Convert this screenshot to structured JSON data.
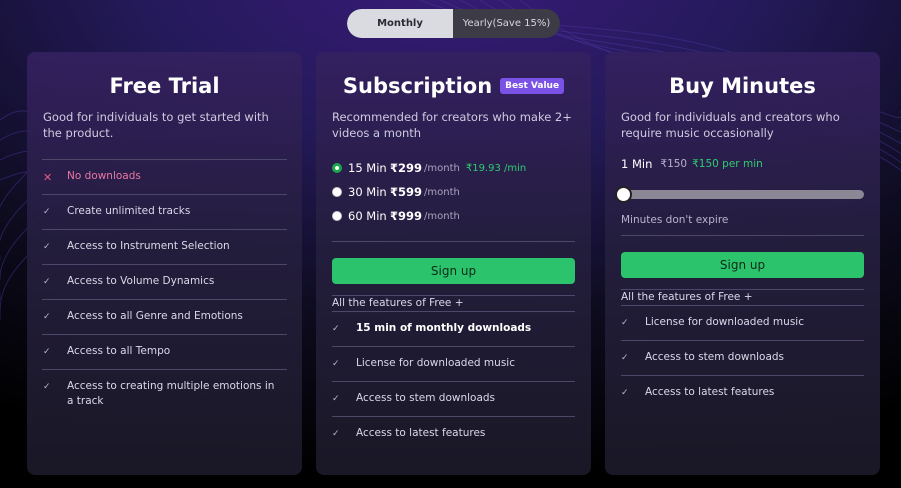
{
  "billing_toggle": {
    "monthly": "Monthly",
    "yearly": "Yearly(Save 15%)"
  },
  "free_trial": {
    "title": "Free Trial",
    "description": "Good for individuals to get started with the product.",
    "features": [
      {
        "text": "No downloads",
        "included": false
      },
      {
        "text": "Create unlimited tracks",
        "included": true
      },
      {
        "text": "Access to Instrument Selection",
        "included": true
      },
      {
        "text": "Access to Volume Dynamics",
        "included": true
      },
      {
        "text": "Access to all Genre and Emotions",
        "included": true
      },
      {
        "text": "Access to all Tempo",
        "included": true
      },
      {
        "text": "Access to creating multiple emotions in a track",
        "included": true
      }
    ]
  },
  "subscription": {
    "title": "Subscription",
    "badge": "Best Value",
    "description": "Recommended for creators who make 2+ videos a month",
    "options": [
      {
        "minutes": "15 Min",
        "price": "₹299",
        "per": "/month",
        "discount": "₹19.93 /min",
        "selected": true
      },
      {
        "minutes": "30 Min",
        "price": "₹599",
        "per": "/month",
        "discount": "",
        "selected": false
      },
      {
        "minutes": "60 Min",
        "price": "₹999",
        "per": "/month",
        "discount": "",
        "selected": false
      }
    ],
    "cta": "Sign up",
    "features_intro": "All the features of Free +",
    "features": [
      {
        "text": "15 min of monthly downloads",
        "bold": true
      },
      {
        "text": "License for downloaded music",
        "bold": false
      },
      {
        "text": "Access to stem downloads",
        "bold": false
      },
      {
        "text": "Access to latest features",
        "bold": false
      }
    ]
  },
  "buy_minutes": {
    "title": "Buy Minutes",
    "description": "Good for individuals and creators who require music occasionally",
    "minutes": "1 Min",
    "price": "₹150",
    "per_minute": "₹150 per min",
    "slider_value": 0,
    "note": "Minutes don't expire",
    "cta": "Sign up",
    "features_intro": "All the features of Free +",
    "features": [
      {
        "text": "License for downloaded music"
      },
      {
        "text": "Access to stem downloads"
      },
      {
        "text": "Access to latest features"
      }
    ]
  },
  "icons": {
    "check": "check-icon",
    "cross": "cross-icon"
  },
  "colors": {
    "accent_green": "#2bc46d",
    "badge_purple": "#7b52e6",
    "cross_pink": "#e25c8a"
  }
}
